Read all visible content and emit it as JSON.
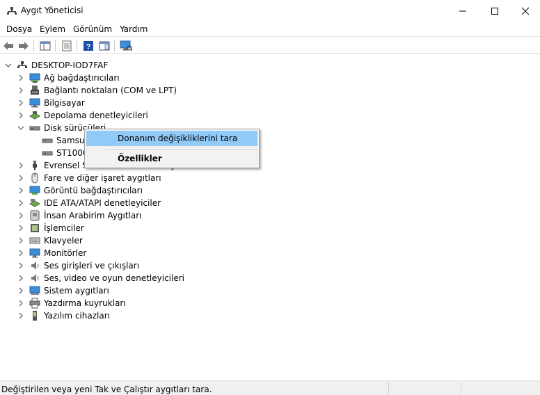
{
  "window": {
    "title": "Aygıt Yöneticisi"
  },
  "menu": [
    "Dosya",
    "Eylem",
    "Görünüm",
    "Yardım"
  ],
  "toolbar": [
    "back-icon",
    "forward-icon",
    "properties-pane-icon",
    "update-list-icon",
    "help-icon",
    "view-icon",
    "monitor-scan-icon"
  ],
  "tree": {
    "root": "DESKTOP-IOD7FAF",
    "items": [
      {
        "label": "Ağ bağdaştırıcıları",
        "icon": "network-adapter-icon",
        "expanded": false
      },
      {
        "label": "Bağlantı noktaları (COM ve LPT)",
        "icon": "port-icon",
        "expanded": false
      },
      {
        "label": "Bilgisayar",
        "icon": "computer-icon",
        "expanded": false
      },
      {
        "label": "Depolama denetleyicileri",
        "icon": "storage-controller-icon",
        "expanded": false
      },
      {
        "label": "Disk sürücüleri",
        "icon": "disk-drive-icon",
        "expanded": true,
        "children": [
          {
            "label": "Samsung"
          },
          {
            "label": "ST1000DM"
          }
        ]
      },
      {
        "label": "Evrensel Seri Veri Yolu denetleyicileri",
        "icon": "usb-icon",
        "expanded": false
      },
      {
        "label": "Fare ve diğer işaret aygıtları",
        "icon": "mouse-icon",
        "expanded": false
      },
      {
        "label": "Görüntü bağdaştırıcıları",
        "icon": "display-adapter-icon",
        "expanded": false
      },
      {
        "label": "IDE ATA/ATAPI denetleyiciler",
        "icon": "ide-icon",
        "expanded": false
      },
      {
        "label": "İnsan Arabirim Aygıtları",
        "icon": "hid-icon",
        "expanded": false
      },
      {
        "label": "İşlemciler",
        "icon": "processor-icon",
        "expanded": false
      },
      {
        "label": "Klavyeler",
        "icon": "keyboard-icon",
        "expanded": false
      },
      {
        "label": "Monitörler",
        "icon": "monitor-icon",
        "expanded": false
      },
      {
        "label": "Ses girişleri ve çıkışları",
        "icon": "audio-io-icon",
        "expanded": false
      },
      {
        "label": "Ses, video ve oyun denetleyicileri",
        "icon": "sound-icon",
        "expanded": false
      },
      {
        "label": "Sistem aygıtları",
        "icon": "system-device-icon",
        "expanded": false
      },
      {
        "label": "Yazdırma kuyrukları",
        "icon": "printer-icon",
        "expanded": false
      },
      {
        "label": "Yazılım cihazları",
        "icon": "software-device-icon",
        "expanded": false
      }
    ]
  },
  "context_menu": {
    "items": [
      {
        "label": "Donanım değişikliklerini tara",
        "highlighted": true
      },
      {
        "label": "Özellikler",
        "bold": true
      }
    ]
  },
  "status": {
    "text": "Değiştirilen veya yeni Tak ve Çalıştır aygıtları tara."
  },
  "colors": {
    "highlight": "#91c9f7",
    "menu_bg": "#f2f2f2",
    "status_bg": "#f0f0f0"
  }
}
